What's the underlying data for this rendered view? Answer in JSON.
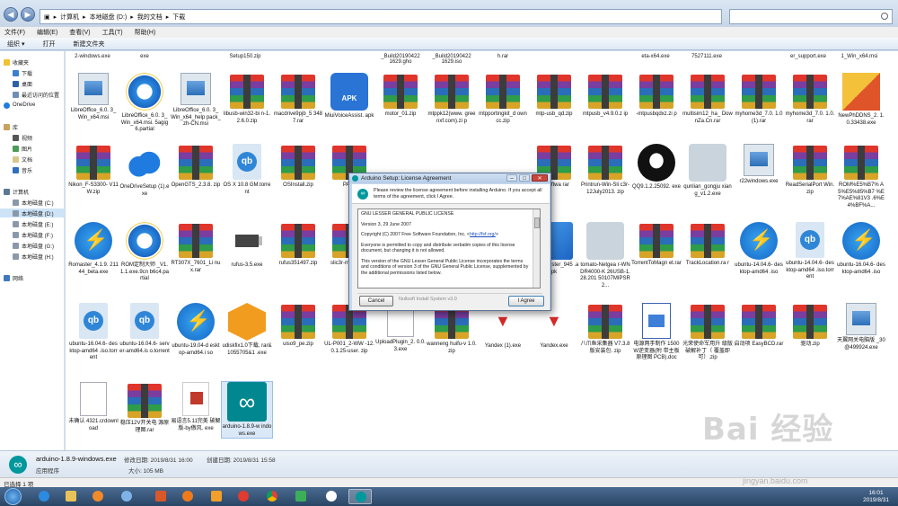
{
  "address_bar": {
    "crumbs": [
      "计算机",
      "本地磁盘 (D:)",
      "我的文档",
      "下载"
    ],
    "separator": "▸",
    "search_placeholder": ""
  },
  "menu": [
    "文件(F)",
    "编辑(E)",
    "查看(V)",
    "工具(T)",
    "帮助(H)"
  ],
  "toolbar": {
    "organize": "组织 ▾",
    "open": "打开",
    "new_folder": "新建文件夹"
  },
  "sidebar": {
    "favorites": "收藏夹",
    "fav_items": [
      "下载",
      "桌面",
      "最近访问的位置"
    ],
    "onedrive": "OneDrive",
    "libraries": "库",
    "lib_items": [
      "视频",
      "图片",
      "文档",
      "音乐"
    ],
    "computer": "计算机",
    "drives": [
      "本地磁盘 (C:)",
      "本地磁盘 (D:)",
      "本地磁盘 (E:)",
      "本地磁盘 (F:)",
      "本地磁盘 (G:)",
      "本地磁盘 (H:)"
    ],
    "network": "网络"
  },
  "top_row_labels": [
    "2-windows.exe",
    "exe",
    "Setup150.zip",
    "_Build20190422 1629.gho",
    "_Build20190422 1629.iso",
    "h.rar",
    "eta-x64.exe",
    "7527111.exe",
    "er_support.exe",
    "1_Win_x64.msi"
  ],
  "files_row1": [
    "LibreOffice_6.0. 3_Win_x64.msi",
    "LibreOffice_6.0. 3_Win_x64.msi. 5agig6.partial",
    "LibreOffice_6.0. 3_Win_x64_help pack_zh-CN.msi",
    "libusb-win32-bi n-1.2.6.0.zip",
    "macdrive9pjb_5 3487.rar",
    "MiuiVoiceAssist. apk",
    "motor_01.zip",
    "mtppk12(www. greenxf.com).zi p",
    "mtpportingkit_d owncc.zip",
    "mtp-usb_qd.zip",
    "mtpusb_v4.9.0.z ip",
    "-mtpusbqdxz.zi p",
    "multisim12_ha_ DownZa.Cn.rar",
    "myhome3d_7.0. 1.0 (1).rar",
    "myhome3d_7.0. 1.0.rar",
    "NewPhDDNS_2. 1.0.33438.exe"
  ],
  "files_row2": [
    "Nikon_F-S3300- V11W.zip",
    "OneDriveSetup (1).exe",
    "OpenGTS_2.3.8. zip",
    "OS X 10.8 GM.torrent",
    "OSInstall.zip",
    "PAGr",
    "",
    "",
    "",
    "C-Softwa rar",
    "Printrun-Win-Sli c3r-12July2013. zip",
    "QQ9.1.2.25092. exe",
    "qunlian_gongju xiang_v1.2.exe",
    "r22windows.exe",
    "ReadSerialPort Win.zip",
    "ROM%E5%B7% A5%E5%85%B7 %E7%AE%81V3 .6%E4%BF%A..."
  ],
  "files_row3": [
    "Romaster_4.1.9. 21144_beta.exe",
    "ROM定制大师 _V1.1.1.exe.9cn b6c4.partial",
    "RT307X_7601_Li nux.rar",
    "rufus-3.5.exe",
    "rufus351497.zip",
    "slic3r-m 6-1-2-9",
    "",
    "",
    "",
    "com.qua ster_945 .apk",
    "tomato-Netgea r-WNDR4000-K 26USB-1.28.201 50107MIPSR2...",
    "TorrentToMagn et.rar",
    "TrackLocation.ra r",
    "ubuntu-14.04.6- desktop-amd64 .iso",
    "ubuntu-14.04.6- desktop-amd64 .iso.torrent",
    "ubuntu-16.04.6- desktop-amd64 .iso"
  ],
  "files_row4": [
    "ubuntu-16.04.6- desktop-amd64 .iso.torrent",
    "ubuntu-16.04.6- server-amd64.is o.torrent",
    "ubuntu-19.04-d esktop-amd64.i so",
    "udiskfix1.0下载. rar&1055705&1 .exe",
    "uiso9_pe.zip",
    "UL-P001_2-WW -12.0.1.25-user. zip",
    "UploadPlugin_2. 0.0.3.exe",
    "wanneng huifu-v 1.0.zip",
    "Yandex (1).exe",
    "Yandex.exe",
    "八爪鱼采集器 V7.3.8版安装包. zip",
    "电源两手制作 1500W逆变器(附 带主板原理图 PCB).doc",
    "光荣使命军用升 级版破解补丁（ 覆盖即可）.zip",
    "启动项 EasyBCD.rar",
    "驱动.zip",
    "天翼网关电脑版 _30@499924.exe"
  ],
  "files_row5": [
    "未确认 4321.crdownload",
    "稳压12V开关电 源原理图.rar",
    "易语言5.11完美 破解版-by傲风. exe",
    "arduino-1.8.9-w indows.exe"
  ],
  "details": {
    "name": "arduino-1.8.9-windows.exe",
    "type": "应用程序",
    "modified_label": "修改日期: 2019/8/31 16:00",
    "size_label": "大小: 105 MB",
    "created_label": "创建日期: 2019/8/31 15:58"
  },
  "status": "已选择 1 项",
  "clock": {
    "time": "16:01",
    "date": "2019/8/31"
  },
  "dialog": {
    "title": "Arduino Setup: License Agreement",
    "header_text": "Please review the license agreement before installing Arduino. If you accept all terms of the agreement, click I Agree.",
    "license_title": "GNU LESSER GENERAL PUBLIC LICENSE",
    "license_version": "Version 3, 29 June 2007",
    "copyright_prefix": "Copyright (C) 2007 Free Software Foundation, Inc. <",
    "copyright_link": "http://fsf.org/",
    "copyright_suffix": ">",
    "paragraph1": "Everyone is permitted to copy and distribute verbatim copies of this license document, but changing it is not allowed.",
    "paragraph2": "This version of the GNU Lesser General Public License incorporates the terms and conditions of version 3 of the GNU General Public License, supplemented by the additional permissions listed below.",
    "nullsoft": "Nullsoft Install System v3.0",
    "cancel": "Cancel",
    "agree": "I Agree",
    "minimize": "–",
    "maximize": "□",
    "close": "✕"
  },
  "watermark": {
    "main": "Bai  经验",
    "sub": "jingyan.baidu.com"
  }
}
